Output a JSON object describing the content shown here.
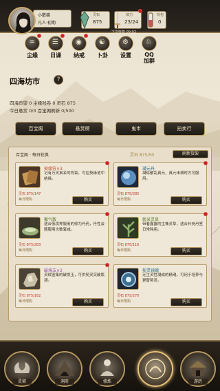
{
  "profile": {
    "name": "小散猫",
    "realm": "凡人·初期"
  },
  "stats": {
    "lingshi": {
      "label": "灵石",
      "value": "875"
    },
    "stamina": {
      "label": "体力",
      "value": "23/24"
    },
    "bag": {
      "label": "背包",
      "value": "0"
    },
    "countdown": "下次恢复 09:02"
  },
  "menu": [
    {
      "label": "尘缘",
      "icon": "gourd-icon"
    },
    {
      "label": "日课",
      "icon": "calendar-icon"
    },
    {
      "label": "纳戒",
      "icon": "ring-icon"
    },
    {
      "label": "卜卦",
      "icon": "divination-icon"
    },
    {
      "label": "设置",
      "icon": "gear-icon"
    },
    {
      "label": "QQ\n加群",
      "icon": "qq-icon"
    }
  ],
  "market": {
    "title": "四海坊市",
    "help": "?",
    "info_line1": "四海声望 0   尘缘残卷 0   灵石 875",
    "info_line2": "今日悬赏 0/3   百宝阁刷新 0/500"
  },
  "tabs": [
    "百宝阁",
    "悬赏榜",
    "鬼市",
    "拍卖行"
  ],
  "panel": {
    "header": "百宝阁 · 每日轮换",
    "refresh_price": "灵石 875/50",
    "refresh_label": "刷新货架",
    "buy_label": "购买"
  },
  "items": [
    {
      "name": "契缘符×3",
      "name_color": "#c04a2a",
      "desc": "记有万灵真名的符箓，可在契缘池中结缘。",
      "price": "灵石 875/147",
      "limit": "每日限购",
      "thumb": "scroll"
    },
    {
      "name": "凝元丹",
      "name_color": "#2f6e8a",
      "desc": "凝练散乱真元，真元未满时方可服用。",
      "price": "灵石 875/285",
      "limit": "每日限购",
      "thumb": "orb"
    },
    {
      "name": "聚气散",
      "name_color": "#5a7a2a",
      "desc": "适合低境界服用的修为丹药，丹性会随服用次数衰减。",
      "price": "灵石 875/283",
      "limit": "每日限购",
      "thumb": "bowl"
    },
    {
      "name": "新采灵草",
      "name_color": "#5a7a2a",
      "desc": "带着露露的生株灵草，适合补充丹室日常耗用。",
      "price": "灵石 875/116",
      "limit": "每日限购",
      "thumb": "herb"
    },
    {
      "name": "破境玉×2",
      "name_color": "#8a4aa8",
      "desc": "灵纹密集的破境玉，可供契灵突破瓶颈。",
      "price": "灵石 875/162",
      "limit": "每日限购",
      "thumb": "ore"
    },
    {
      "name": "契灵镜魄",
      "name_color": "#2f6e8a",
      "desc": "无主灵性凝成的精魂，可用于培养与更替契灵。",
      "price": "灵石 875/270",
      "limit": "每日限购",
      "thumb": "mirror"
    }
  ],
  "bottom_nav": [
    {
      "label": "灵契",
      "icon": "spirit-icon"
    },
    {
      "label": "洞府",
      "icon": "cave-icon"
    },
    {
      "label": "修炼",
      "icon": "meditate-icon"
    },
    {
      "label": "坊市",
      "icon": "market-icon"
    },
    {
      "label": "游历",
      "icon": "travel-icon"
    }
  ]
}
